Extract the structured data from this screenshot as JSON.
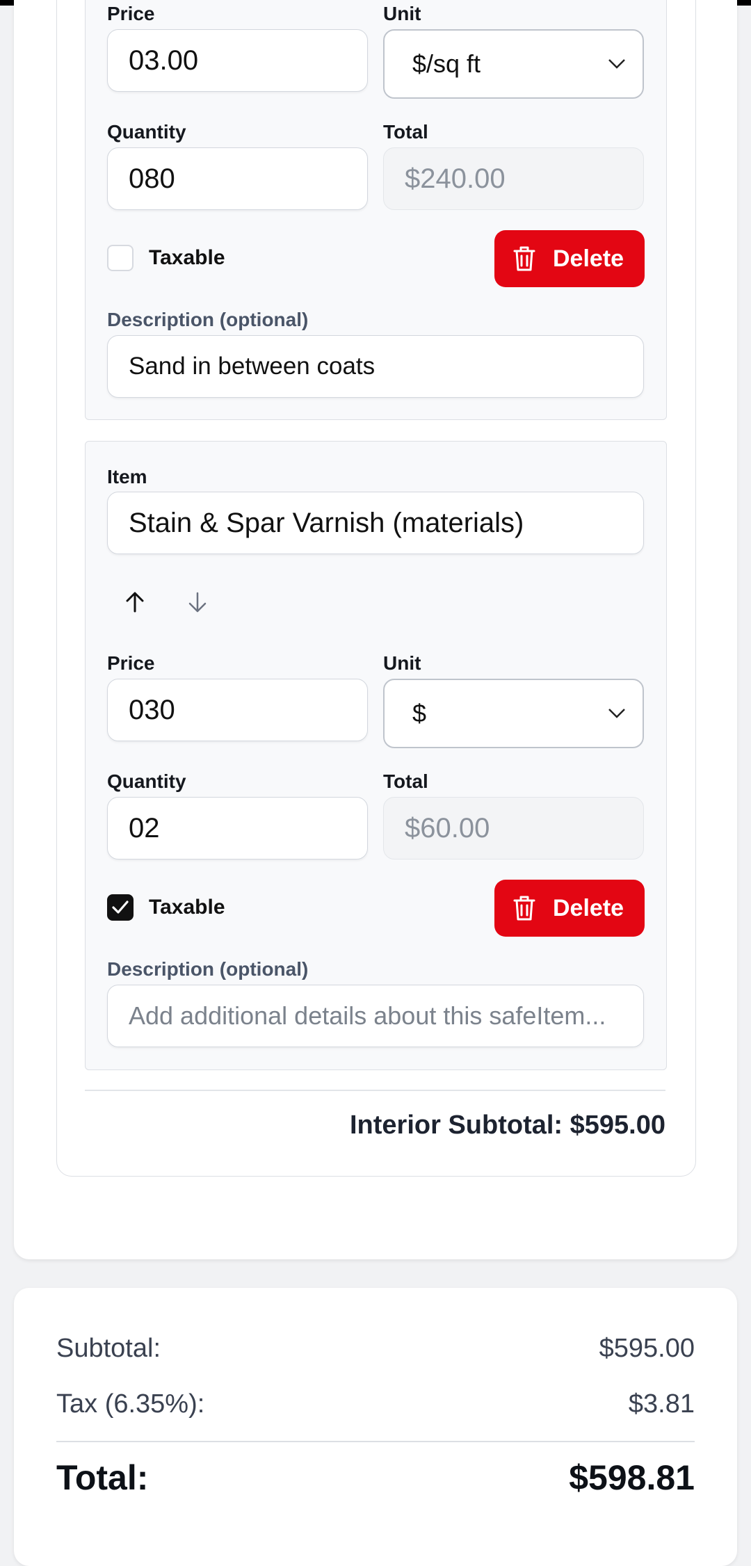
{
  "items": [
    {
      "price_label": "Price",
      "price": "03.00",
      "unit_label": "Unit",
      "unit": "$/sq ft",
      "quantity_label": "Quantity",
      "quantity": "080",
      "total_label": "Total",
      "total": "$240.00",
      "taxable_label": "Taxable",
      "taxable": false,
      "delete_label": "Delete",
      "description_label": "Description (optional)",
      "description": "Sand in between coats"
    },
    {
      "item_label": "Item",
      "item": "Stain & Spar Varnish (materials)",
      "price_label": "Price",
      "price": "030",
      "unit_label": "Unit",
      "unit": "$",
      "quantity_label": "Quantity",
      "quantity": "02",
      "total_label": "Total",
      "total": "$60.00",
      "taxable_label": "Taxable",
      "taxable": true,
      "delete_label": "Delete",
      "description_label": "Description (optional)",
      "description_placeholder": "Add additional details about this safeItem..."
    }
  ],
  "section": {
    "subtotal_text": "Interior Subtotal: $595.00"
  },
  "summary": {
    "subtotal_label": "Subtotal:",
    "subtotal_value": "$595.00",
    "tax_label": "Tax (6.35%):",
    "tax_value": "$3.81",
    "total_label": "Total:",
    "total_value": "$598.81"
  },
  "colors": {
    "accent_delete": "#e30613",
    "checkbox_checked": "#111111"
  },
  "icons": {
    "delete": "trash-icon",
    "move_up": "arrow-up-icon",
    "move_down": "arrow-down-icon",
    "select": "chevron-down-icon"
  }
}
